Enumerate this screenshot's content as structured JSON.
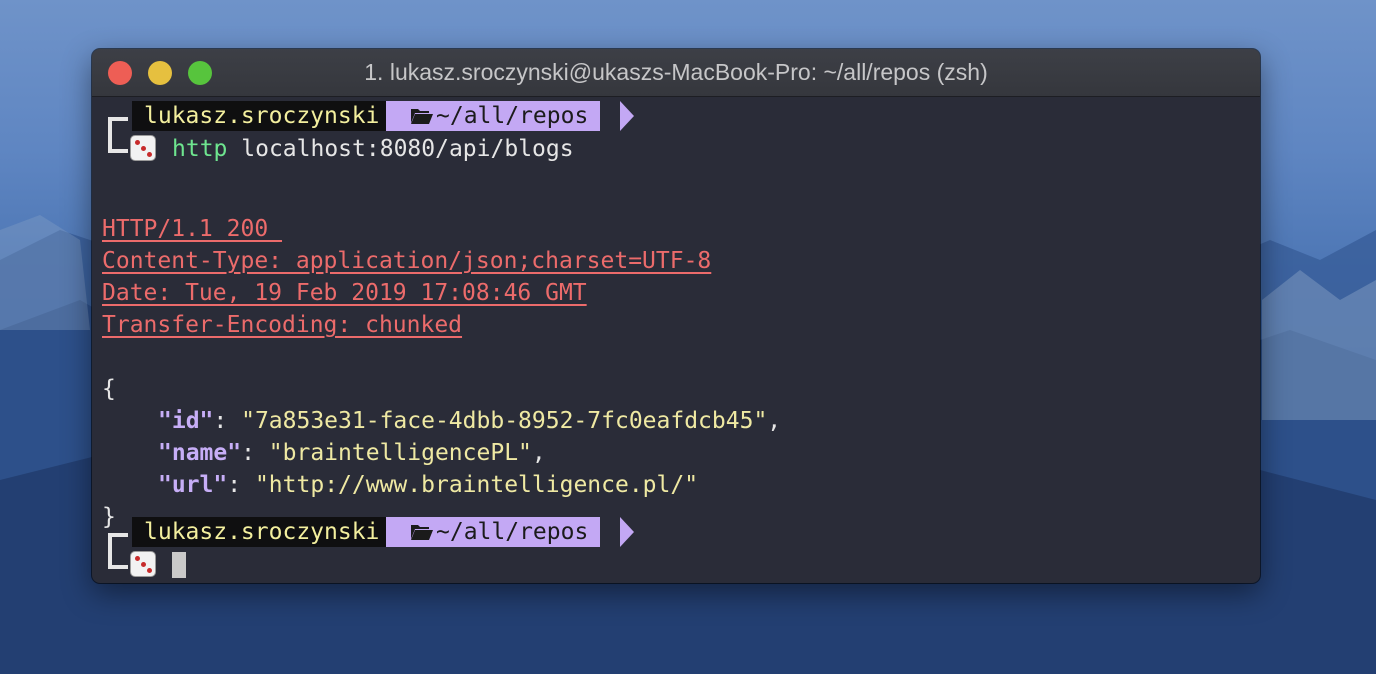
{
  "window": {
    "title": "1. lukasz.sroczynski@ukaszs-MacBook-Pro: ~/all/repos (zsh)"
  },
  "prompt": {
    "user": "lukasz.sroczynski",
    "path": "~/all/repos",
    "path_icon": "folder-open-icon",
    "prompt_icon": "dice-icon"
  },
  "command": {
    "program": "http",
    "args": "localhost:8080/api/blogs"
  },
  "response": {
    "status_line": "HTTP/1.1 200 ",
    "headers": [
      "Content-Type: application/json;charset=UTF-8",
      "Date: Tue, 19 Feb 2019 17:08:46 GMT",
      "Transfer-Encoding: chunked"
    ],
    "open_brace": "{",
    "close_brace": "}",
    "fields": [
      {
        "key": "\"id\"",
        "value": "\"7a853e31-face-4dbb-8952-7fc0eafdcb45\"",
        "trail": ","
      },
      {
        "key": "\"name\"",
        "value": "\"braintelligencePL\"",
        "trail": ","
      },
      {
        "key": "\"url\"",
        "value": "\"http://www.braintelligence.pl/\"",
        "trail": ""
      }
    ],
    "colon": ": "
  },
  "colors": {
    "user_bg": "#0f0f10",
    "user_fg": "#f3ef9e",
    "path_bg": "#c3a8f4",
    "header_red": "#ec6b6b",
    "json_key": "#c7aef7",
    "json_string": "#efe9a3",
    "command_green": "#6ee58f",
    "terminal_bg": "#2a2c38"
  }
}
